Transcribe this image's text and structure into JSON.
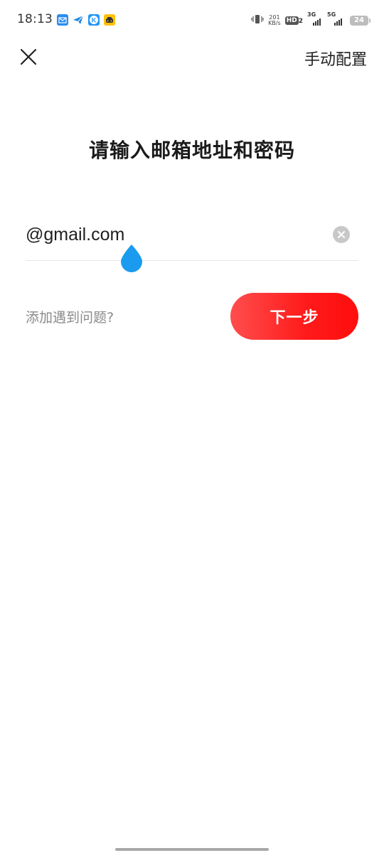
{
  "status_bar": {
    "time": "18:13",
    "app_icons": [
      "mail-app-icon",
      "send-app-icon",
      "k-app-icon",
      "taxi-app-icon"
    ],
    "net_speed_value": "201",
    "net_speed_unit": "KB/s",
    "hd_label": "HD",
    "hd_sub": "2",
    "signal_1_label": "3G",
    "signal_2_label": "5G",
    "battery_level": "24"
  },
  "header": {
    "close_icon": "close-icon",
    "manual_config_label": "手动配置"
  },
  "main": {
    "title": "请输入邮箱地址和密码",
    "email_value": "@gmail.com",
    "clear_icon": "clear-circle-icon",
    "help_link_label": "添加遇到问题?",
    "next_button_label": "下一步"
  },
  "colors": {
    "accent": "#ff1f1f",
    "cursor_handle": "#1a9bf0"
  }
}
